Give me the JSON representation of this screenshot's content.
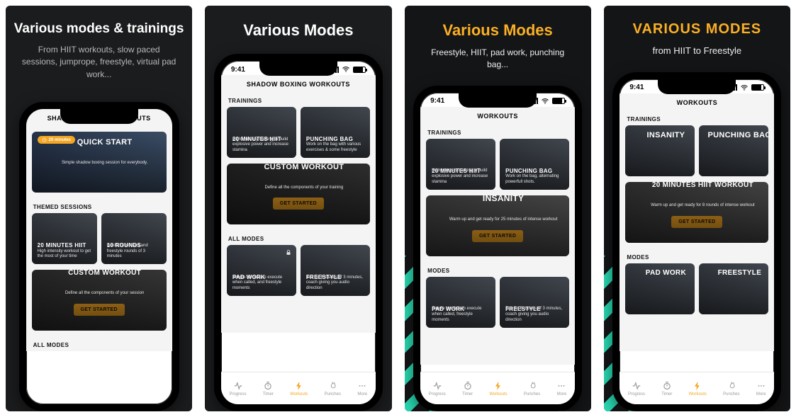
{
  "panels": [
    {
      "headline": "Various modes & trainings",
      "subhead": "From HIIT workouts, slow paced sessions, jumprope, freestyle, virtual pad work...",
      "app_title": "SHADOW BOXING WORKOUTS",
      "badge": "20 minutes",
      "hero": {
        "title": "QUICK START",
        "desc": "Simple shadow boxing session for everybody."
      },
      "section1": "THEMED SESSIONS",
      "c1": {
        "title": "20 MINUTES HIIT",
        "desc": "High intensity workout to get the most of your time"
      },
      "c2": {
        "title": "10 ROUNDS",
        "desc": "Guided exercises and freestyle rounds of 3 minutes"
      },
      "custom": {
        "title": "CUSTOM WORKOUT",
        "desc": "Define all the components of your session",
        "btn": "GET STARTED"
      },
      "section2": "ALL MODES"
    },
    {
      "headline": "Various Modes",
      "time": "9:41",
      "app_title": "SHADOW BOXING WORKOUTS",
      "section1": "TRAININGS",
      "c1": {
        "title": "20 MINUTES HIIT",
        "desc": "High intensity training to build explosive power and increase stamina"
      },
      "c2": {
        "title": "PUNCHING BAG",
        "desc": "Work on the bag with various exercises & some freestyle"
      },
      "custom": {
        "title": "CUSTOM WORKOUT",
        "desc": "Define all the components of your training",
        "btn": "GET STARTED"
      },
      "section2": "ALL MODES",
      "m1": {
        "title": "PAD WORK",
        "desc": "Simple combos to execute when called, and freestyle moments"
      },
      "m2": {
        "title": "FREESTYLE",
        "desc": "Box for 6 rounds of 3 minutes, coach giving you audio direction"
      },
      "tabs": [
        "Progress",
        "Timer",
        "Workouts",
        "Punches",
        "More"
      ]
    },
    {
      "headline": "Various Modes",
      "subhead": "Freestyle, HIIT, pad work, punching bag...",
      "time": "9:41",
      "app_title": "WORKOUTS",
      "section1": "TRAININGS",
      "c1": {
        "title": "20 MINUTES HIIT",
        "desc": "High intensity training to build explosive power and increase stamina"
      },
      "c2": {
        "title": "PUNCHING BAG",
        "desc": "Work on the bag, alternating powerfull shots."
      },
      "featured": {
        "title": "INSANITY",
        "desc": "Warm up and get ready for 25 minutes of intense workout",
        "btn": "GET STARTED"
      },
      "section2": "MODES",
      "m1": {
        "title": "PAD WORK",
        "desc": "Simple combos to execute when called, freestyle moments"
      },
      "m2": {
        "title": "FREESTYLE",
        "desc": "Box for 6 rounds of 3 minutes, coach giving you audio direction"
      },
      "tabs": [
        "Progress",
        "Timer",
        "Workouts",
        "Punches",
        "More"
      ]
    },
    {
      "headline": "VARIOUS MODES",
      "subhead": "from HIIT to Freestyle",
      "time": "9:41",
      "app_title": "WORKOUTS",
      "section1": "TRAININGS",
      "c1": {
        "title": "INSANITY"
      },
      "c2": {
        "title": "PUNCHING BAG"
      },
      "featured": {
        "title": "20 MINUTES HIIT WORKOUT",
        "desc": "Warm up and get ready for 8 rounds of intense workout",
        "btn": "GET STARTED"
      },
      "section2": "MODES",
      "m1": {
        "title": "PAD WORK"
      },
      "m2": {
        "title": "FREESTYLE"
      },
      "tabs": [
        "Progress",
        "Timer",
        "Workouts",
        "Punches",
        "More"
      ]
    }
  ]
}
